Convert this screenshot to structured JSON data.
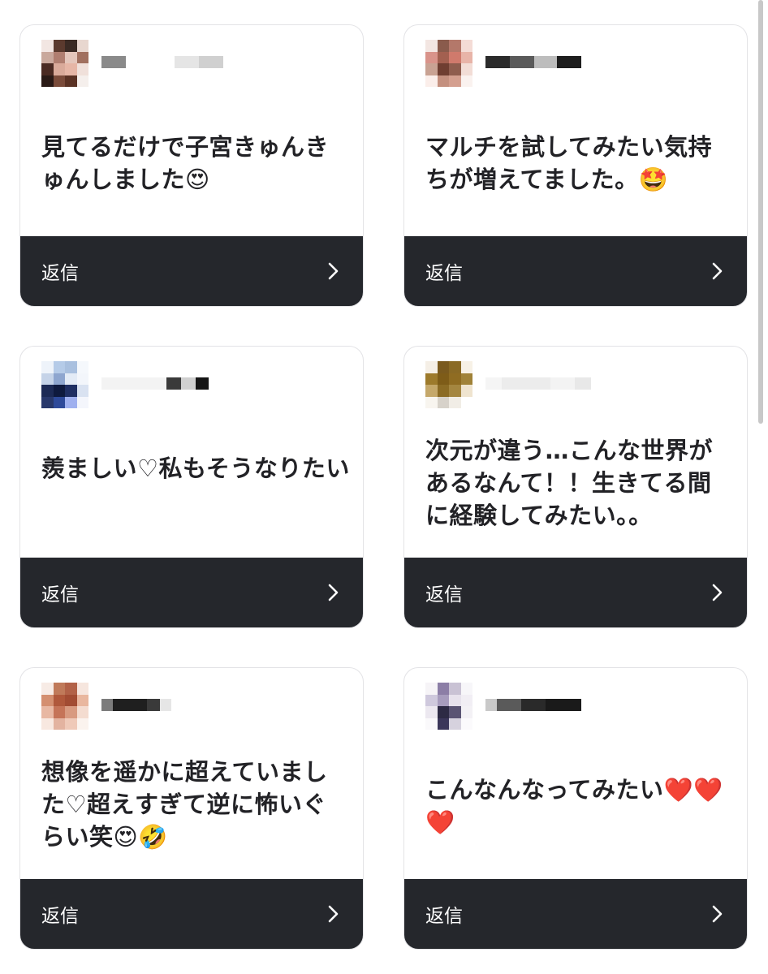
{
  "cards": [
    {
      "comment": "見てるだけで子宮きゅんきゅんしました😍",
      "reply_label": "返信",
      "avatar_colors": [
        "#f2e6e2",
        "#5b3a2e",
        "#3a2a24",
        "#e8d7cf",
        "#c9a89c",
        "#b07e70",
        "#e4c6bb",
        "#a1705f",
        "#4a2a22",
        "#d9aa9a",
        "#e6b6a6",
        "#f0e0da",
        "#2a1a16",
        "#7a4b3a",
        "#5a3224",
        "#f5efec"
      ],
      "username_colors": [
        "#8a8a8a",
        "#ffffff",
        "#e5e5e5",
        "#d0d0d0"
      ]
    },
    {
      "comment": "マルチを試してみたい気持ちが増えてました。🤩",
      "reply_label": "返信",
      "avatar_colors": [
        "#f3e6e2",
        "#8a5b4c",
        "#b4786a",
        "#f4dcd6",
        "#d9938a",
        "#a36050",
        "#d07a6c",
        "#e8b4a8",
        "#c9a293",
        "#6f3e31",
        "#8f5d4e",
        "#f2ddd6",
        "#fbeeea",
        "#c4907f",
        "#d49f8f",
        "#faf2ef"
      ],
      "username_colors": [
        "#2b2b2b",
        "#5a5a5a",
        "#bdbdbd",
        "#1e1e1e"
      ]
    },
    {
      "comment": "羨ましい♡私もそうなりたい",
      "reply_label": "返信",
      "avatar_colors": [
        "#eef3fa",
        "#b5cbe8",
        "#a9c0df",
        "#f5f8fc",
        "#c5d3e8",
        "#8ea6cf",
        "#e3ebf6",
        "#f3f6fb",
        "#1c2a55",
        "#0e1a3e",
        "#1f2f63",
        "#d9e2f1",
        "#28386b",
        "#2e4a9a",
        "#9fb0ef",
        "#f4f6fc"
      ],
      "username_colors": [
        "#f3f3f3",
        "#3a3a3a",
        "#d0d0d0",
        "#151515"
      ]
    },
    {
      "comment": "次元が違う…こんな世界があるなんて！！生きてる間に経験してみたい。。",
      "reply_label": "返信",
      "avatar_colors": [
        "#f5efe6",
        "#7a5a1e",
        "#8a6a25",
        "#f7f1e6",
        "#9d7a2b",
        "#7e5c18",
        "#8f6c22",
        "#a08238",
        "#c5a86a",
        "#8b6b24",
        "#a48640",
        "#efe4cf",
        "#f8f5ef",
        "#d7d2ca",
        "#f1ede6",
        "#ffffff"
      ],
      "username_colors": [
        "#f5f5f5",
        "#ececec",
        "#f3f3f3",
        "#e8e8e8"
      ]
    },
    {
      "comment": "想像を遥かに超えていました♡超えすぎて逆に怖いぐらい笑😍🤣",
      "reply_label": "返信",
      "avatar_colors": [
        "#f7ebe5",
        "#c07a5a",
        "#b26248",
        "#f6e6de",
        "#d48f70",
        "#b0583b",
        "#a24c33",
        "#e9b79f",
        "#e8b8a3",
        "#c57458",
        "#d89a80",
        "#f4dcd0",
        "#f8e8e0",
        "#e3b3a0",
        "#efc9b8",
        "#fbf3ee"
      ],
      "username_colors": [
        "#7c7c7c",
        "#1f1f1f",
        "#3a3a3a",
        "#e6e6e6"
      ]
    },
    {
      "comment": "こんなんなってみたい❤️❤️❤️",
      "reply_label": "返信",
      "avatar_colors": [
        "#f6f4f7",
        "#8c7ea6",
        "#c9c2d4",
        "#f7f6f9",
        "#cfc9dd",
        "#a79cbd",
        "#e7e2ec",
        "#f1eef4",
        "#ece8f0",
        "#2d2a44",
        "#5a5473",
        "#f3f1f5",
        "#faf9fb",
        "#3b365a",
        "#d6d2de",
        "#fbfafc"
      ],
      "username_colors": [
        "#c9c9c9",
        "#5a5a5a",
        "#2a2a2a",
        "#1a1a1a"
      ]
    }
  ]
}
